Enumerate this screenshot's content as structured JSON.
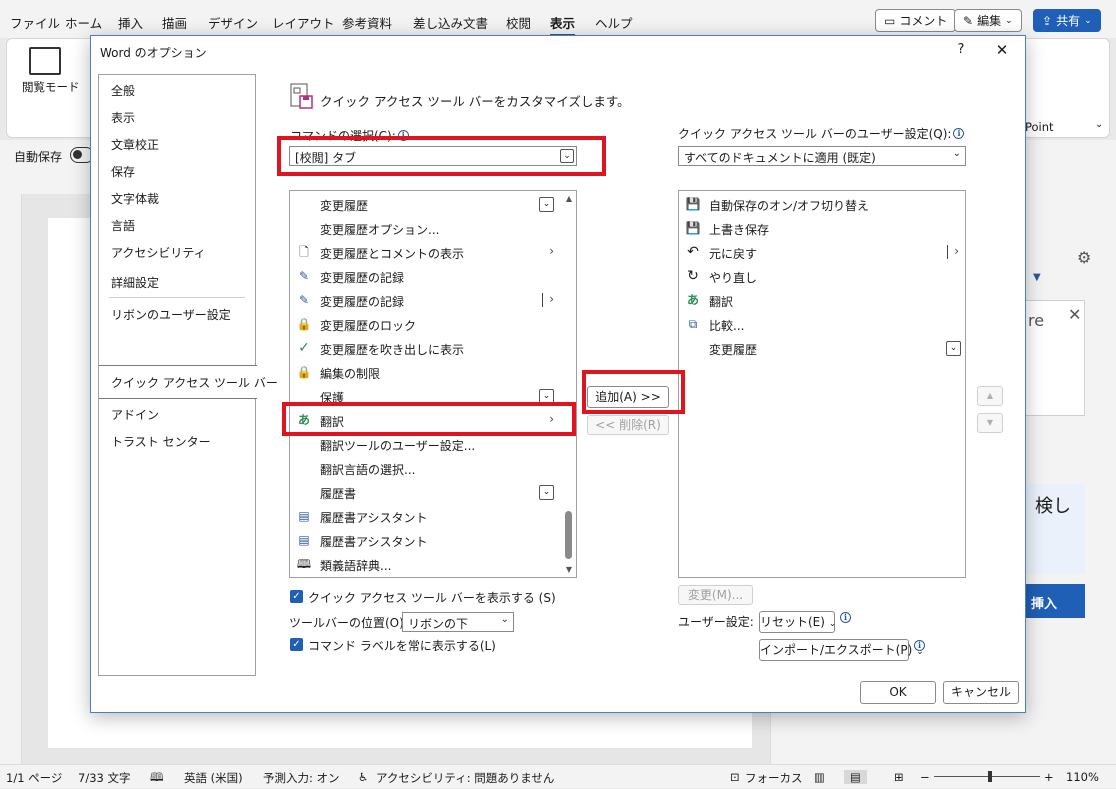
{
  "word": {
    "menu_tabs": [
      "ファイル",
      "ホーム",
      "挿入",
      "描画",
      "デザイン",
      "レイアウト",
      "参考資料",
      "差し込み文書",
      "校閲",
      "表示",
      "ヘルプ"
    ],
    "comment_button": "コメント",
    "edit_button": "編集",
    "share_button": "共有",
    "ribbon_reading_mode": "閲覧モード",
    "ribbon_point": "Point",
    "autosave_label": "自動保存",
    "pane_text_re": "re",
    "pane_text_kanji": "検し",
    "pane_insert": "挿入",
    "status": {
      "page": "1/1 ページ",
      "words": "7/33 文字",
      "language": "英語 (米国)",
      "prediction": "予測入力: オン",
      "accessibility": "アクセシビリティ: 問題ありません",
      "focus": "フォーカス",
      "zoom": "110%"
    }
  },
  "dialog": {
    "title": "Word のオプション",
    "help": "?",
    "nav": [
      "全般",
      "表示",
      "文章校正",
      "保存",
      "文字体裁",
      "言語",
      "アクセシビリティ",
      "詳細設定",
      "リボンのユーザー設定",
      "クイック アクセス ツール バー",
      "アドイン",
      "トラスト センター"
    ],
    "header": "クイック アクセス ツール バーをカスタマイズします。",
    "command_label": "コマンドの選択(C):",
    "command_value": "[校閲] タブ",
    "customize_label": "クイック アクセス ツール バーのユーザー設定(Q):",
    "customize_value": "すべてのドキュメントに適用 (既定)",
    "commands": [
      "変更履歴",
      "変更履歴オプション...",
      "変更履歴とコメントの表示",
      "変更履歴の記録",
      "変更履歴の記録",
      "変更履歴のロック",
      "変更履歴を吹き出しに表示",
      "編集の制限",
      "保護",
      "翻訳",
      "翻訳ツールのユーザー設定...",
      "翻訳言語の選択...",
      "履歴書",
      "履歴書アシスタント",
      "履歴書アシスタント",
      "類義語辞典..."
    ],
    "qat_items": [
      "自動保存のオン/オフ切り替え",
      "上書き保存",
      "元に戻す",
      "やり直し",
      "翻訳",
      "比較...",
      "変更履歴"
    ],
    "add_button": "追加(A) >>",
    "remove_button": "<< 削除(R)",
    "modify_button": "変更(M)...",
    "user_settings_label": "ユーザー設定:",
    "reset_button": "リセット(E)",
    "import_export_button": "インポート/エクスポート(P)",
    "show_qat_label": "クイック アクセス ツール バーを表示する (S)",
    "toolbar_position_label": "ツールバーの位置(O)",
    "toolbar_position_value": "リボンの下",
    "always_show_labels": "コマンド ラベルを常に表示する(L)",
    "ok": "OK",
    "cancel": "キャンセル"
  },
  "colors": {
    "accent": "#2b579a",
    "highlight": "#e0141e",
    "save_icon": "#b4307e",
    "translate_green": "#2e8b57",
    "lock_orange": "#d98a1e"
  }
}
